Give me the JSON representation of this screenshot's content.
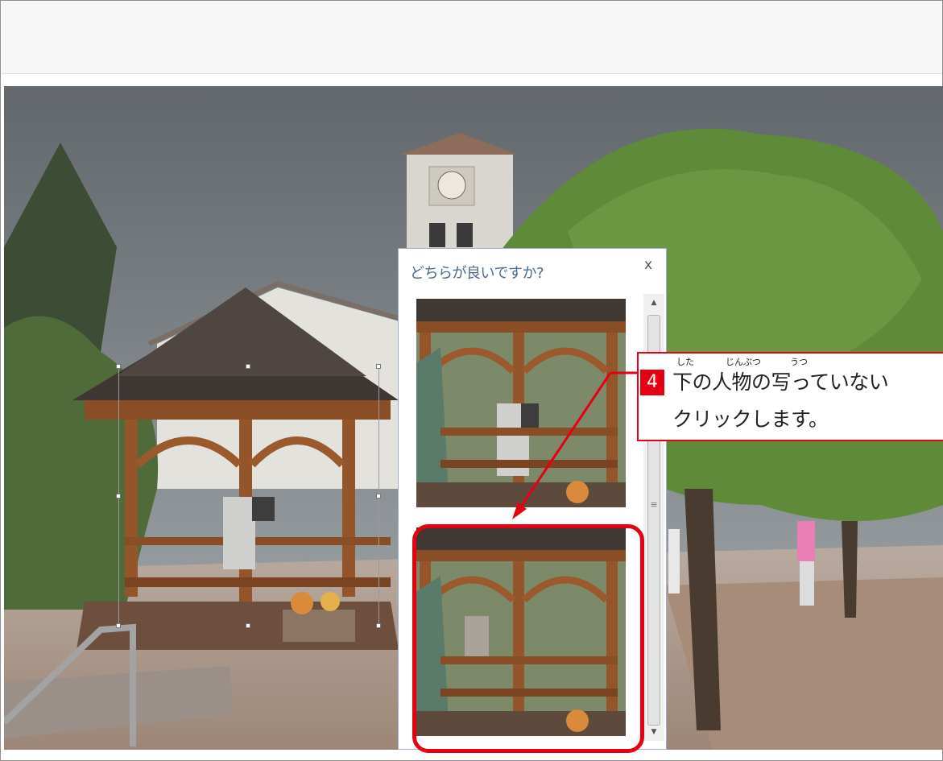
{
  "dialog": {
    "title": "どちらが良いですか?",
    "close_symbol": "x",
    "options": [
      {
        "name": "photo-with-person"
      },
      {
        "name": "photo-without-person"
      }
    ]
  },
  "callout": {
    "step_number": "4",
    "line1": "下の人物の写っていない",
    "line2": "クリックします。",
    "ruby": {
      "shita": "した",
      "jinbutsu": "じんぶつ",
      "utsu": "うつ"
    }
  },
  "colors": {
    "accent_red": "#e60012",
    "dialog_title": "#4a6a8a"
  },
  "icons": {
    "close": "close-icon",
    "scroll_up": "scroll-up-arrow-icon",
    "scroll_down": "scroll-down-arrow-icon"
  }
}
